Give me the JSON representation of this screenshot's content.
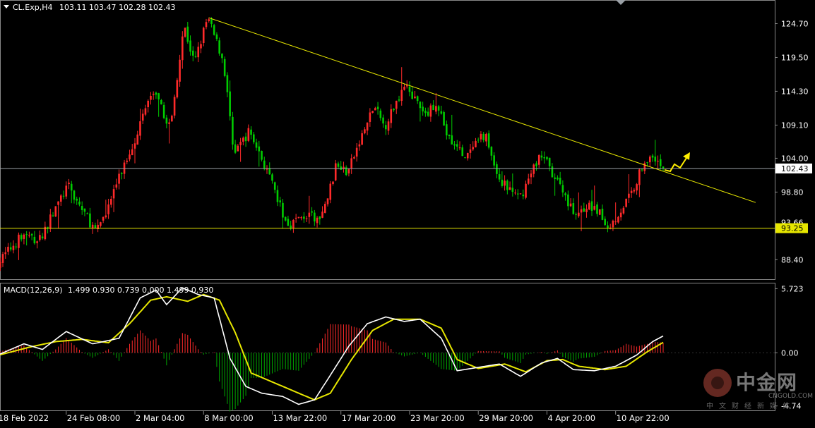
{
  "chart_data": [
    {
      "type": "candlestick",
      "title": "CL.Exp,H4",
      "ohlc_label": "103.11 103.47 102.28 102.43",
      "y_ticks": [
        "124.70",
        "119.50",
        "114.30",
        "109.10",
        "104.00",
        "98.80",
        "88.40"
      ],
      "ylim": [
        85.4,
        127.9
      ],
      "x_ticks": [
        "18 Feb 2022",
        "24 Feb 08:00",
        "2 Mar 04:00",
        "8 Mar 00:00",
        "13 Mar 22:00",
        "17 Mar 20:00",
        "23 Mar 20:00",
        "29 Mar 20:00",
        "4 Apr 20:00",
        "10 Apr 22:00"
      ],
      "current_price": "102.43",
      "support_level": "93.25",
      "hidden_level_label": "93.66",
      "trendline": {
        "from": {
          "bar": 78,
          "price": 125.6
        },
        "to": {
          "bar": 285,
          "price": 97.2
        }
      },
      "colors": {
        "bull": "#FF2A2A",
        "bear": "#00CC00",
        "trendline": "#E6E600",
        "support": "#E6E600",
        "grid": "#888888",
        "arrow": "#FFEE00"
      },
      "swing_path": [
        {
          "bar": -2,
          "price": 87.6
        },
        {
          "bar": 8,
          "price": 92.3
        },
        {
          "bar": 14,
          "price": 91.2
        },
        {
          "bar": 25,
          "price": 99.8
        },
        {
          "bar": 36,
          "price": 92.5
        },
        {
          "bar": 45,
          "price": 101.5
        },
        {
          "bar": 50,
          "price": 106.5
        },
        {
          "bar": 57,
          "price": 114.3
        },
        {
          "bar": 64,
          "price": 108.8
        },
        {
          "bar": 69,
          "price": 124.6
        },
        {
          "bar": 73,
          "price": 118.5
        },
        {
          "bar": 78,
          "price": 125.6
        },
        {
          "bar": 84,
          "price": 119.0
        },
        {
          "bar": 88,
          "price": 105.0
        },
        {
          "bar": 94,
          "price": 108.2
        },
        {
          "bar": 100,
          "price": 102.5
        },
        {
          "bar": 108,
          "price": 93.8
        },
        {
          "bar": 115,
          "price": 95.2
        },
        {
          "bar": 121,
          "price": 94.5
        },
        {
          "bar": 127,
          "price": 103.2
        },
        {
          "bar": 131,
          "price": 101.8
        },
        {
          "bar": 141,
          "price": 112.0
        },
        {
          "bar": 145,
          "price": 108.8
        },
        {
          "bar": 153,
          "price": 115.8
        },
        {
          "bar": 160,
          "price": 110.3
        },
        {
          "bar": 165,
          "price": 112.8
        },
        {
          "bar": 169,
          "price": 107.0
        },
        {
          "bar": 176,
          "price": 104.0
        },
        {
          "bar": 183,
          "price": 107.8
        },
        {
          "bar": 188,
          "price": 101.0
        },
        {
          "bar": 196,
          "price": 97.6
        },
        {
          "bar": 204,
          "price": 104.8
        },
        {
          "bar": 210,
          "price": 100.8
        },
        {
          "bar": 217,
          "price": 95.5
        },
        {
          "bar": 224,
          "price": 96.8
        },
        {
          "bar": 230,
          "price": 93.4
        },
        {
          "bar": 238,
          "price": 98.2
        },
        {
          "bar": 244,
          "price": 104.2
        },
        {
          "bar": 250,
          "price": 102.43
        }
      ]
    },
    {
      "type": "line",
      "title": "MACD(12,26,9)",
      "values_label": "1.499 0.930 0.739 0.000 1.499 0.930",
      "y_ticks": [
        "5.723",
        "0.00",
        "-4.74"
      ],
      "ylim": [
        -5.2,
        6.0
      ],
      "colors": {
        "macd": "#FFFFFF",
        "signal": "#E6E600",
        "hist_up": "#FF2A2A",
        "hist_down": "#00AA00"
      },
      "series": [
        {
          "name": "MACD",
          "points": [
            {
              "bar": -3,
              "value": -0.3
            },
            {
              "bar": 8,
              "value": 0.8
            },
            {
              "bar": 15,
              "value": 0.3
            },
            {
              "bar": 24,
              "value": 1.9
            },
            {
              "bar": 34,
              "value": 0.8
            },
            {
              "bar": 44,
              "value": 1.3
            },
            {
              "bar": 52,
              "value": 4.9
            },
            {
              "bar": 58,
              "value": 5.6
            },
            {
              "bar": 62,
              "value": 4.3
            },
            {
              "bar": 68,
              "value": 5.8
            },
            {
              "bar": 74,
              "value": 5.2
            },
            {
              "bar": 80,
              "value": 4.9
            },
            {
              "bar": 86,
              "value": -0.5
            },
            {
              "bar": 92,
              "value": -3.0
            },
            {
              "bar": 98,
              "value": -3.6
            },
            {
              "bar": 106,
              "value": -3.9
            },
            {
              "bar": 112,
              "value": -4.6
            },
            {
              "bar": 118,
              "value": -4.2
            },
            {
              "bar": 124,
              "value": -2.0
            },
            {
              "bar": 131,
              "value": 0.6
            },
            {
              "bar": 138,
              "value": 2.6
            },
            {
              "bar": 145,
              "value": 3.2
            },
            {
              "bar": 152,
              "value": 2.8
            },
            {
              "bar": 158,
              "value": 3.0
            },
            {
              "bar": 166,
              "value": 1.3
            },
            {
              "bar": 172,
              "value": -1.6
            },
            {
              "bar": 180,
              "value": -1.3
            },
            {
              "bar": 188,
              "value": -1.0
            },
            {
              "bar": 196,
              "value": -2.1
            },
            {
              "bar": 204,
              "value": -0.9
            },
            {
              "bar": 210,
              "value": -0.5
            },
            {
              "bar": 216,
              "value": -1.5
            },
            {
              "bar": 224,
              "value": -1.6
            },
            {
              "bar": 232,
              "value": -1.2
            },
            {
              "bar": 240,
              "value": -0.2
            },
            {
              "bar": 246,
              "value": 1.0
            },
            {
              "bar": 250,
              "value": 1.5
            }
          ]
        },
        {
          "name": "Signal",
          "points": [
            {
              "bar": -3,
              "value": -0.3
            },
            {
              "bar": 10,
              "value": 0.5
            },
            {
              "bar": 20,
              "value": 1.0
            },
            {
              "bar": 30,
              "value": 1.2
            },
            {
              "bar": 40,
              "value": 0.9
            },
            {
              "bar": 48,
              "value": 2.6
            },
            {
              "bar": 56,
              "value": 4.7
            },
            {
              "bar": 62,
              "value": 5.0
            },
            {
              "bar": 70,
              "value": 4.6
            },
            {
              "bar": 76,
              "value": 5.2
            },
            {
              "bar": 82,
              "value": 4.7
            },
            {
              "bar": 88,
              "value": 1.8
            },
            {
              "bar": 94,
              "value": -1.8
            },
            {
              "bar": 102,
              "value": -2.6
            },
            {
              "bar": 110,
              "value": -3.4
            },
            {
              "bar": 118,
              "value": -4.2
            },
            {
              "bar": 124,
              "value": -3.6
            },
            {
              "bar": 132,
              "value": -0.6
            },
            {
              "bar": 140,
              "value": 2.0
            },
            {
              "bar": 148,
              "value": 3.0
            },
            {
              "bar": 158,
              "value": 3.0
            },
            {
              "bar": 166,
              "value": 2.2
            },
            {
              "bar": 172,
              "value": -0.6
            },
            {
              "bar": 180,
              "value": -1.4
            },
            {
              "bar": 190,
              "value": -1.0
            },
            {
              "bar": 198,
              "value": -1.7
            },
            {
              "bar": 206,
              "value": -0.7
            },
            {
              "bar": 212,
              "value": -0.6
            },
            {
              "bar": 218,
              "value": -1.2
            },
            {
              "bar": 228,
              "value": -1.5
            },
            {
              "bar": 236,
              "value": -1.2
            },
            {
              "bar": 244,
              "value": 0.1
            },
            {
              "bar": 250,
              "value": 0.93
            }
          ]
        }
      ]
    }
  ],
  "watermark": {
    "brand": "中金网",
    "url": "CNGOLD.COM",
    "sub": "中文财经新媒体"
  }
}
